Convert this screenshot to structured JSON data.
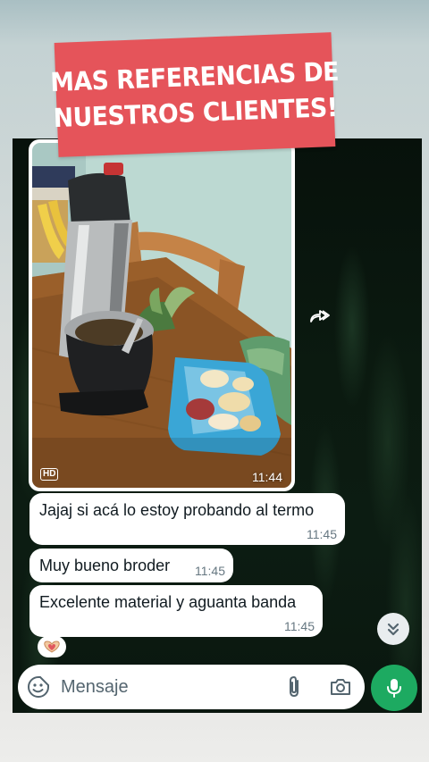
{
  "story_banner": {
    "line1": "MAS REFERENCIAS DE",
    "line2": "NUESTROS CLIENTES!",
    "color": "#e5545a"
  },
  "chat": {
    "photo_message": {
      "quality_badge": "HD",
      "time": "11:44",
      "forward_icon": "forward-icon"
    },
    "messages": [
      {
        "text": "Jajaj si acá lo estoy probando al termo",
        "time": "11:45"
      },
      {
        "text": "Muy bueno broder",
        "time": "11:45"
      },
      {
        "text": "Excelente material y aguanta banda",
        "time": "11:45"
      }
    ],
    "reaction": {
      "emoji": "heart-hands",
      "icon": "heart-hands-icon"
    },
    "scroll_down_icon": "double-chevron-down-icon"
  },
  "composer": {
    "placeholder": "Mensaje",
    "icons": [
      "sticker-icon",
      "paperclip-icon",
      "camera-icon",
      "microphone-icon"
    ],
    "send_color": "#1daa61"
  }
}
